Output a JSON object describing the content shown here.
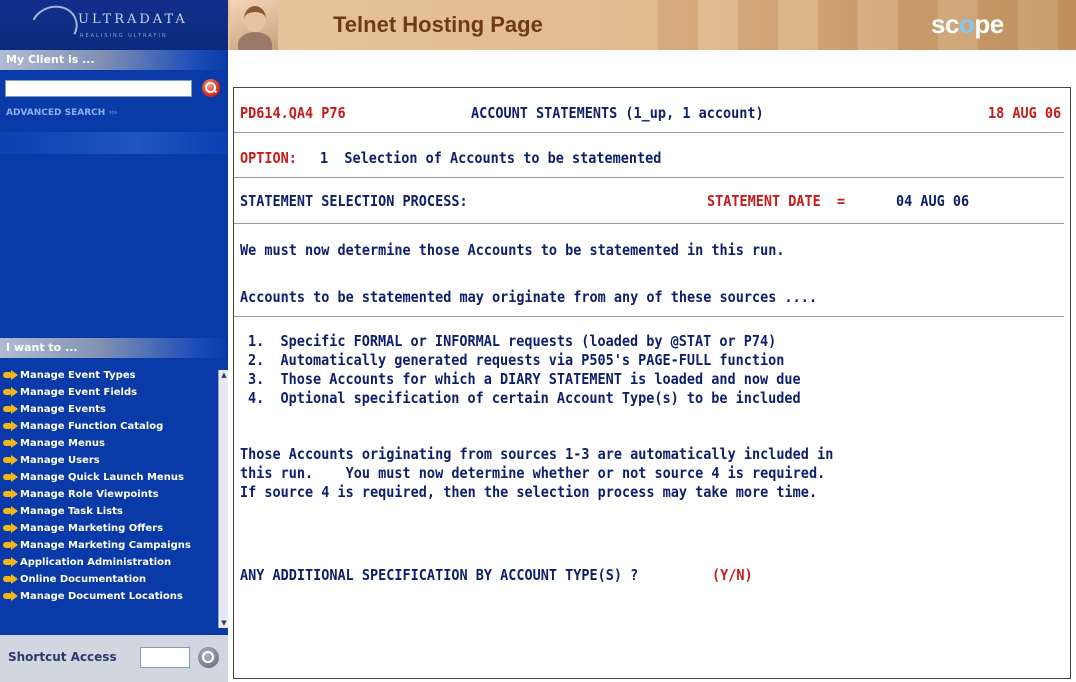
{
  "sidebar": {
    "logo_text": "ULTRADATA",
    "logo_tagline": "REALISING ULTRAFIN",
    "client_heading": "My Client is ...",
    "search_value": "",
    "advanced_search": "ADVANCED SEARCH",
    "iwant_heading": "I want to ...",
    "menu_items": [
      "Manage Event Types",
      "Manage Event Fields",
      "Manage Events",
      "Manage Function Catalog",
      "Manage Menus",
      "Manage Users",
      "Manage Quick Launch Menus",
      "Manage Role Viewpoints",
      "Manage Task Lists",
      "Manage Marketing Offers",
      "Manage Marketing Campaigns",
      "Application Administration",
      "Online Documentation",
      "Manage Document Locations"
    ],
    "shortcut_label": "Shortcut Access",
    "shortcut_value": ""
  },
  "header": {
    "title": "Telnet Hosting Page",
    "logo_left": "sc",
    "logo_dot": "o",
    "logo_right": "pe"
  },
  "terminal": {
    "program_id": "PD614.QA4 P76",
    "screen_title": "ACCOUNT STATEMENTS (1_up, 1 account)",
    "date": "18 AUG 06",
    "option_label": "OPTION:",
    "option_value": "1  Selection of Accounts to be statemented",
    "process_label": "STATEMENT SELECTION PROCESS:",
    "statement_date_label": "STATEMENT DATE  =",
    "statement_date_value": "04 AUG 06",
    "intro_1": "We must now determine those Accounts to be statemented in this run.",
    "intro_2": "Accounts to be statemented may originate from any of these sources ....",
    "sources": [
      "1.  Specific FORMAL or INFORMAL requests (loaded by @STAT or P74)",
      "2.  Automatically generated requests via P505's PAGE-FULL function",
      "3.  Those Accounts for which a DIARY STATEMENT is loaded and now due",
      "4.  Optional specification of certain Account Type(s) to be included"
    ],
    "paragraph": [
      "Those Accounts originating from sources 1-3 are automatically included in",
      "this run.    You must now determine whether or not source 4 is required.",
      "If source 4 is required, then the selection process may take more time."
    ],
    "prompt": "ANY ADDITIONAL SPECIFICATION BY ACCOUNT TYPE(S) ?",
    "prompt_options": "(Y/N)"
  },
  "colors": {
    "sidebar_bg": "#0a3aa8",
    "terminal_text": "#0e1e6e",
    "terminal_accent": "#c81a1a",
    "header_title": "#6e3c12",
    "menu_arrow": "#f2b81a"
  },
  "icons": {
    "search": "search-icon",
    "shortcut_go": "magnifier-icon",
    "menu_bullet": "arrow-right-icon"
  }
}
